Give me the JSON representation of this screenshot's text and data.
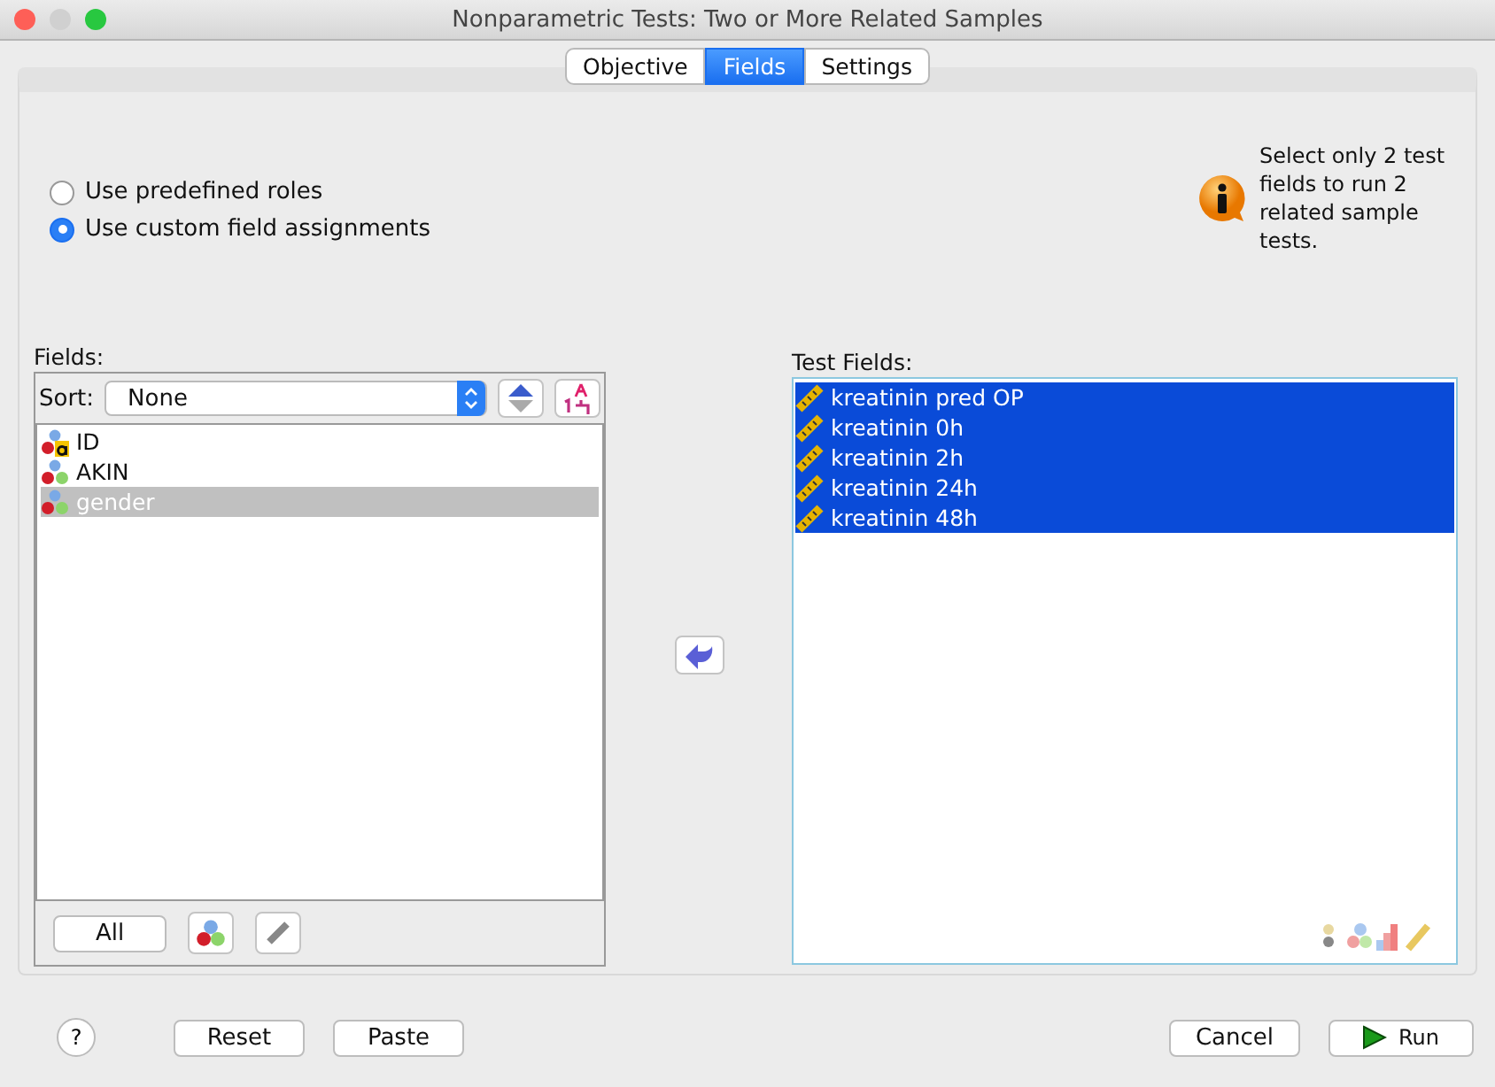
{
  "window": {
    "title": "Nonparametric Tests: Two or More Related Samples"
  },
  "tabs": [
    {
      "label": "Objective",
      "selected": false
    },
    {
      "label": "Fields",
      "selected": true
    },
    {
      "label": "Settings",
      "selected": false
    }
  ],
  "roles": [
    {
      "label": "Use predefined roles",
      "selected": false
    },
    {
      "label": "Use custom field assignments",
      "selected": true
    }
  ],
  "info": "Select only 2 test fields to run 2 related sample tests.",
  "fields": {
    "label": "Fields:",
    "sort_label": "Sort:",
    "sort_value": "None",
    "items": [
      {
        "name": "ID",
        "kind": "string",
        "selected": false
      },
      {
        "name": "AKIN",
        "kind": "nominal",
        "selected": false
      },
      {
        "name": "gender",
        "kind": "nominal",
        "selected": true
      }
    ],
    "all_button": "All"
  },
  "test_fields": {
    "label": "Test Fields:",
    "items": [
      {
        "name": "kreatinin pred OP",
        "kind": "scale",
        "selected": true
      },
      {
        "name": "kreatinin 0h",
        "kind": "scale",
        "selected": true
      },
      {
        "name": "kreatinin 2h",
        "kind": "scale",
        "selected": true
      },
      {
        "name": "kreatinin 24h",
        "kind": "scale",
        "selected": true
      },
      {
        "name": "kreatinin 48h",
        "kind": "scale",
        "selected": true
      }
    ]
  },
  "buttons": {
    "help": "?",
    "reset": "Reset",
    "paste": "Paste",
    "cancel": "Cancel",
    "run": "Run"
  }
}
